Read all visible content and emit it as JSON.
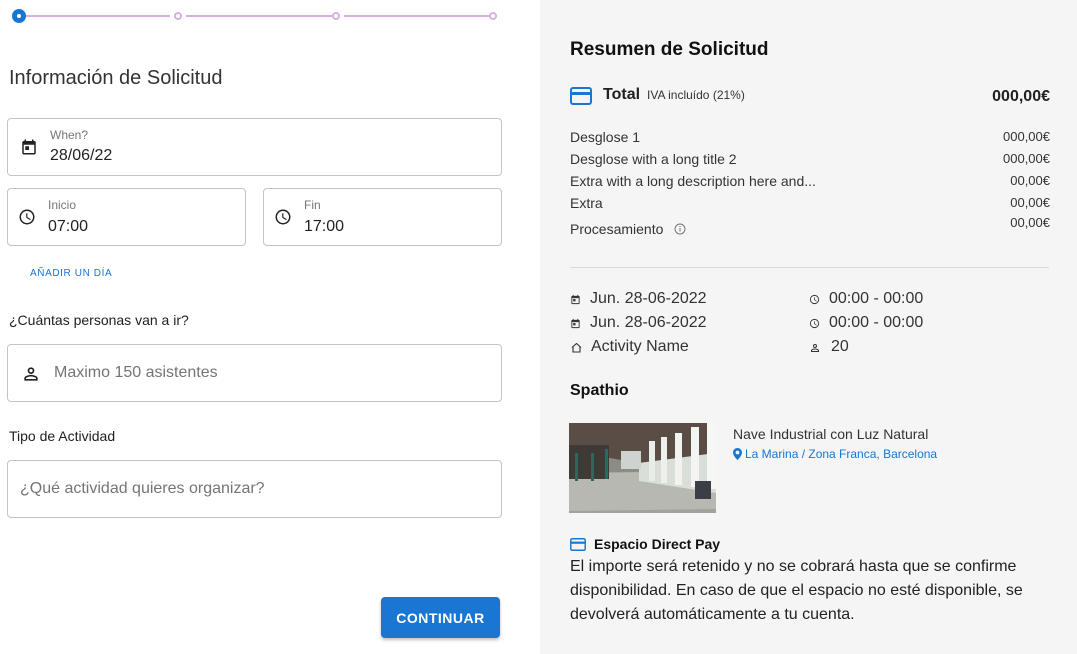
{
  "form": {
    "title": "Información de Solicitud",
    "when": {
      "label": "When?",
      "value": "28/06/22"
    },
    "start": {
      "label": "Inicio",
      "value": "07:00"
    },
    "end": {
      "label": "Fin",
      "value": "17:00"
    },
    "add_day_label": "AÑADIR UN DÍA",
    "people_question": "¿Cuántas personas van a ir?",
    "people_placeholder": "Maximo 150 asistentes",
    "activity_type_label": "Tipo de Actividad",
    "activity_placeholder": "¿Qué actividad quieres organizar?",
    "continue_label": "CONTINUAR"
  },
  "stepper": {
    "steps": 4,
    "current": 1
  },
  "summary": {
    "title": "Resumen de Solicitud",
    "total_label": "Total",
    "total_tax_note": "IVA incluído (21%)",
    "total_amount": "000,00€",
    "breakdown": [
      {
        "label": "Desglose 1",
        "value": "000,00€"
      },
      {
        "label": "Desglose with a long title 2",
        "value": "000,00€"
      },
      {
        "label": "Extra with a long description here and...",
        "value": "00,00€"
      },
      {
        "label": "Extra",
        "value": "00,00€"
      },
      {
        "label": "Procesamiento",
        "value": "00,00€"
      }
    ],
    "schedule": [
      {
        "date": "Jun. 28-06-2022",
        "time": "00:00 - 00:00"
      },
      {
        "date": "Jun. 28-06-2022",
        "time": "00:00 - 00:00"
      }
    ],
    "activity_name": "Activity Name",
    "attendees": "20",
    "provider": "Spathio",
    "space_name": "Nave Industrial con Luz Natural",
    "space_location": "La Marina / Zona Franca, Barcelona",
    "direct_pay_title": "Espacio Direct Pay",
    "direct_pay_text": "El importe será retenido y no se cobrará hasta que se confirme disponibilidad. En caso de que el espacio no esté disponible, se devolverá automáticamente a tu cuenta."
  },
  "colors": {
    "accent": "#1976d2",
    "stepper_inactive": "#d6b0de",
    "panel_bg": "#f5f5f5"
  },
  "icons": [
    "calendar-icon",
    "clock-icon",
    "person-icon",
    "credit-card-icon",
    "info-icon",
    "home-icon",
    "location-pin-icon"
  ]
}
